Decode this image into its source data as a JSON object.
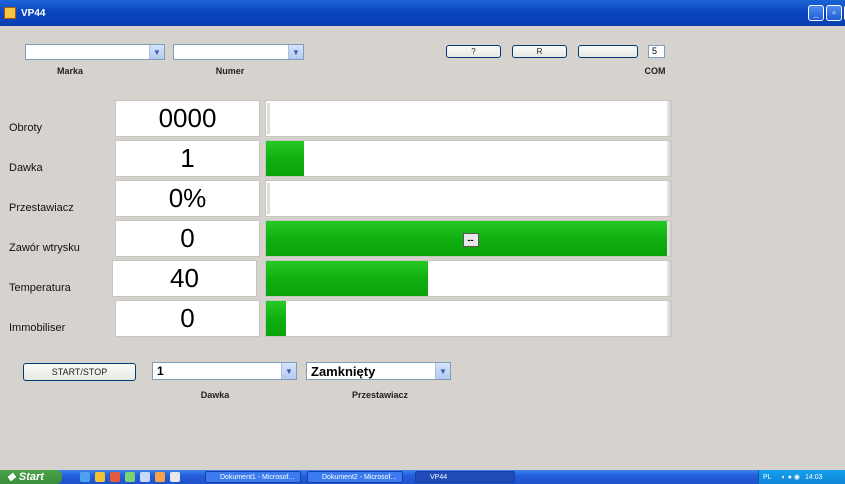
{
  "window": {
    "title": "VP44"
  },
  "top": {
    "marka": {
      "value": "",
      "caption": "Marka"
    },
    "numer": {
      "value": "",
      "caption": "Numer"
    },
    "buttons": {
      "question": "?",
      "r": "R",
      "blank": ""
    },
    "com": {
      "value": "5",
      "caption": "COM"
    }
  },
  "rows": [
    {
      "label": "Obroty",
      "value": "0000",
      "fill": 0.0
    },
    {
      "label": "Dawka",
      "value": "1",
      "fill": 0.095
    },
    {
      "label": "Przestawiacz",
      "value": "0%",
      "fill": 0.0
    },
    {
      "label": "Zawór wtrysku",
      "value": "0",
      "fill": 1.0,
      "center_label": "--"
    },
    {
      "label": "Temperatura",
      "value": "40",
      "fill": 0.4
    },
    {
      "label": "Immobiliser",
      "value": "0",
      "fill": 0.05
    }
  ],
  "bottom": {
    "start_stop": "START/STOP",
    "dawka": {
      "value": "1",
      "caption": "Dawka"
    },
    "przestawiacz": {
      "value": "Zamknięty",
      "caption": "Przestawiacz"
    }
  },
  "taskbar": {
    "start": "Start",
    "items": [
      "Dokument1 - Microsof...",
      "Dokument2 - Microsof...",
      "VP44"
    ],
    "tray": {
      "lang": "PL",
      "time": "14:03"
    }
  },
  "colors": {
    "bar_fill": "#10b010",
    "title_bar": "#0a46c0",
    "background": "#d6d3ce"
  }
}
